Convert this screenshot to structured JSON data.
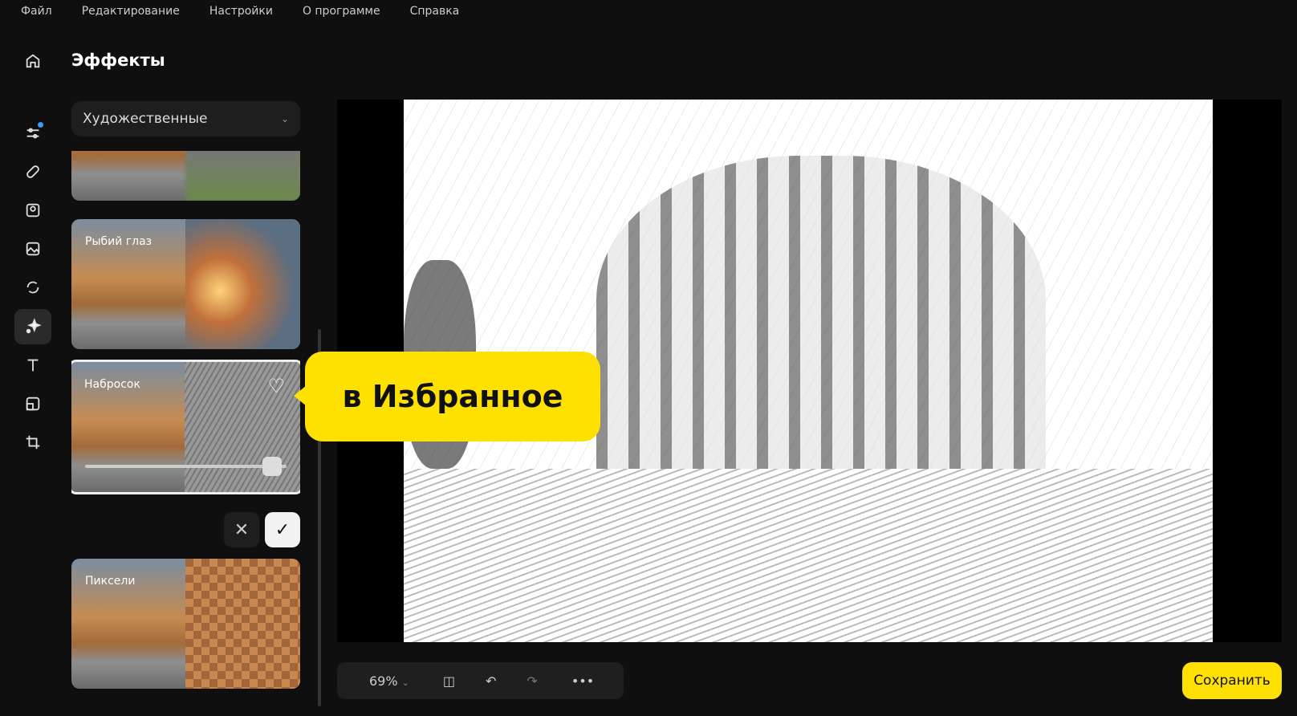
{
  "menu": [
    "Файл",
    "Редактирование",
    "Настройки",
    "О программе",
    "Справка"
  ],
  "panel": {
    "title": "Эффекты",
    "category": "Художественные"
  },
  "effects": [
    {
      "label": "Рыбий глаз"
    },
    {
      "label": "Набросок",
      "strength": 0.93
    },
    {
      "label": "Пиксели"
    }
  ],
  "callout": "в Избранное",
  "toolbar": {
    "zoom": "69%"
  },
  "save_label": "Сохранить",
  "colors": {
    "accent": "#ffe100",
    "background": "#0f0f0f"
  }
}
